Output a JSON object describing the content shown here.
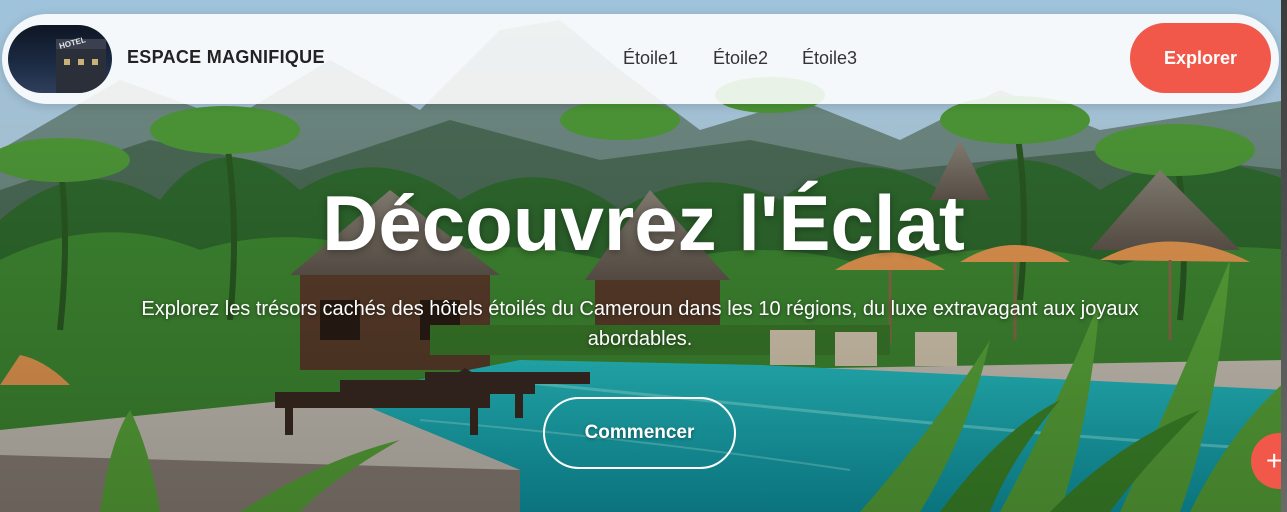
{
  "navbar": {
    "brand": "ESPACE MAGNIFIQUE",
    "logo_text": "HOTEL",
    "links": [
      "Étoile1",
      "Étoile2",
      "Étoile3"
    ],
    "cta_label": "Explorer"
  },
  "hero": {
    "title": "Découvrez l'Éclat",
    "subtitle": "Explorez les trésors cachés des hôtels étoilés du Cameroun dans les 10 régions, du luxe extravagant aux joyaux abordables.",
    "button_label": "Commencer"
  },
  "fab": {
    "icon": "plus-icon",
    "label": "+"
  },
  "colors": {
    "accent": "#f2584a",
    "navbar_bg": "#ffffff",
    "pool": "#1fb7b8"
  }
}
